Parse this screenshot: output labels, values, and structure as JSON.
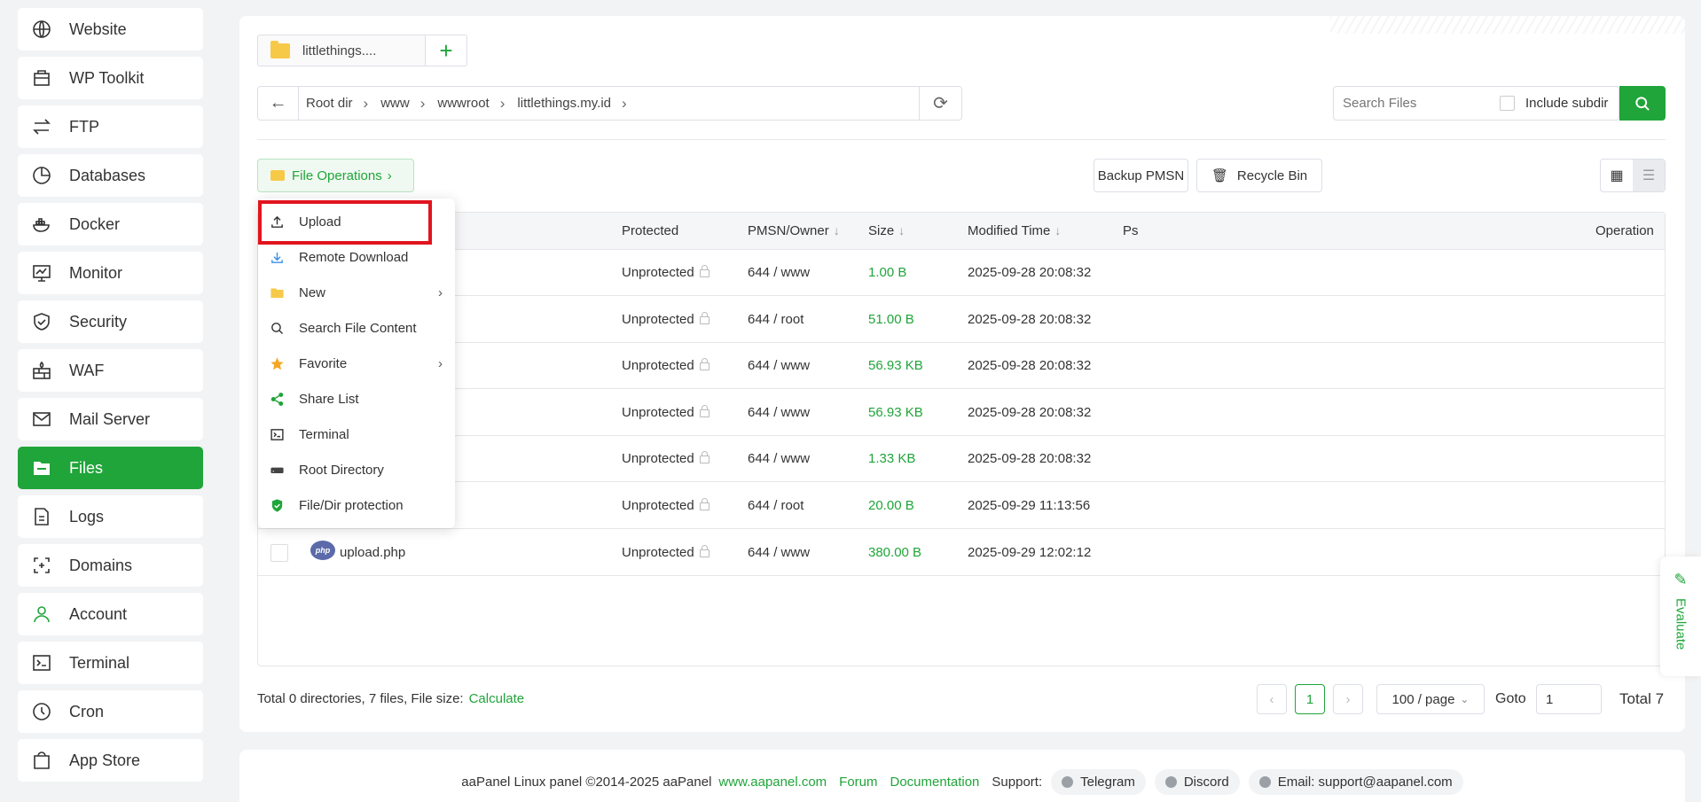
{
  "sidebar": {
    "items": [
      {
        "label": "Website",
        "icon": "globe-icon"
      },
      {
        "label": "WP Toolkit",
        "icon": "toolkit-icon"
      },
      {
        "label": "FTP",
        "icon": "transfer-icon"
      },
      {
        "label": "Databases",
        "icon": "database-icon"
      },
      {
        "label": "Docker",
        "icon": "docker-icon"
      },
      {
        "label": "Monitor",
        "icon": "monitor-icon"
      },
      {
        "label": "Security",
        "icon": "shield-icon"
      },
      {
        "label": "WAF",
        "icon": "firewall-icon"
      },
      {
        "label": "Mail Server",
        "icon": "mail-icon"
      },
      {
        "label": "Files",
        "icon": "folder-icon"
      },
      {
        "label": "Logs",
        "icon": "log-icon"
      },
      {
        "label": "Domains",
        "icon": "domain-icon"
      },
      {
        "label": "Account",
        "icon": "user-icon"
      },
      {
        "label": "Terminal",
        "icon": "terminal-icon"
      },
      {
        "label": "Cron",
        "icon": "clock-icon"
      },
      {
        "label": "App Store",
        "icon": "store-icon"
      }
    ],
    "active": "Files"
  },
  "tabs": {
    "current": "littlethings....",
    "add": "+"
  },
  "path": {
    "crumbs": [
      "Root dir",
      "www",
      "wwwroot",
      "littlethings.my.id"
    ]
  },
  "search": {
    "placeholder": "Search Files",
    "include_subdir": "Include subdir"
  },
  "toolbar": {
    "file_operations": "File Operations",
    "backup": "Backup PMSN",
    "recycle": "Recycle Bin"
  },
  "table": {
    "headers": {
      "protected": "Protected",
      "owner": "PMSN/Owner",
      "size": "Size",
      "modified": "Modified Time",
      "ps": "Ps",
      "operation": "Operation"
    },
    "rows": [
      {
        "name": "",
        "protected": "Unprotected",
        "owner": "644 / www",
        "size": "1.00 B",
        "modified": "2025-09-28 20:08:32"
      },
      {
        "name": "",
        "protected": "Unprotected",
        "owner": "644 / root",
        "size": "51.00 B",
        "modified": "2025-09-28 20:08:32"
      },
      {
        "name": "",
        "protected": "Unprotected",
        "owner": "644 / www",
        "size": "56.93 KB",
        "modified": "2025-09-28 20:08:32"
      },
      {
        "name": "",
        "protected": "Unprotected",
        "owner": "644 / www",
        "size": "56.93 KB",
        "modified": "2025-09-28 20:08:32"
      },
      {
        "name": "",
        "protected": "Unprotected",
        "owner": "644 / www",
        "size": "1.33 KB",
        "modified": "2025-09-28 20:08:32"
      },
      {
        "name": "",
        "protected": "Unprotected",
        "owner": "644 / root",
        "size": "20.00 B",
        "modified": "2025-09-29 11:13:56"
      },
      {
        "name": "upload.php",
        "protected": "Unprotected",
        "owner": "644 / www",
        "size": "380.00 B",
        "modified": "2025-09-29 12:02:12"
      }
    ]
  },
  "menu": {
    "items": [
      {
        "label": "Upload",
        "icon": "upload-icon"
      },
      {
        "label": "Remote Download",
        "icon": "download-icon"
      },
      {
        "label": "New",
        "icon": "folder-icon",
        "submenu": true
      },
      {
        "label": "Search File Content",
        "icon": "search-icon"
      },
      {
        "label": "Favorite",
        "icon": "star-icon",
        "submenu": true
      },
      {
        "label": "Share List",
        "icon": "share-icon"
      },
      {
        "label": "Terminal",
        "icon": "terminal-icon"
      },
      {
        "label": "Root Directory",
        "icon": "drive-icon"
      },
      {
        "label": "File/Dir protection",
        "icon": "shield-check-icon"
      }
    ]
  },
  "stats": {
    "summary": "Total 0 directories, 7 files, File size:",
    "calculate": "Calculate"
  },
  "pagination": {
    "current": "1",
    "per_page": "100 / page",
    "goto_label": "Goto",
    "goto_value": "1",
    "total": "Total 7"
  },
  "evaluate": "Evaluate",
  "footer": {
    "copyright": "aaPanel Linux panel ©2014-2025 aaPanel",
    "site": "www.aapanel.com",
    "forum": "Forum",
    "docs": "Documentation",
    "support": "Support:",
    "telegram": "Telegram",
    "discord": "Discord",
    "email": "Email: support@aapanel.com"
  },
  "colors": {
    "accent": "#20a53a",
    "highlight": "#e1141e"
  }
}
